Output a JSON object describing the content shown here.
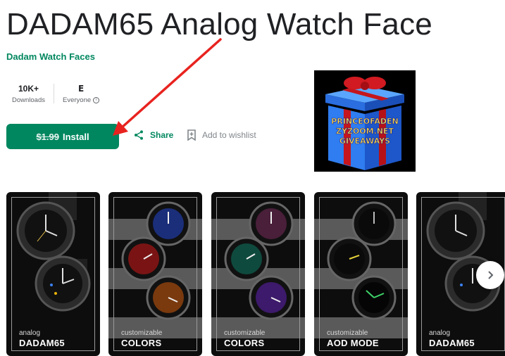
{
  "app": {
    "title": "DADAM65 Analog Watch Face",
    "developer": "Dadam Watch Faces"
  },
  "stats": {
    "downloads_value": "10K+",
    "downloads_label": "Downloads",
    "rating_label": "Everyone"
  },
  "actions": {
    "old_price": "$1.99",
    "install_label": "Install",
    "share_label": "Share",
    "wishlist_label": "Add to wishlist"
  },
  "promo": {
    "lines": [
      "PRINCEOFADEN",
      "ZYZOOM.NET",
      "GIVEAWAYS"
    ]
  },
  "screenshots": [
    {
      "small": "analog",
      "big": "DADAM65"
    },
    {
      "small": "customizable",
      "big": "COLORS"
    },
    {
      "small": "customizable",
      "big": "COLORS"
    },
    {
      "small": "customizable",
      "big": "AOD MODE"
    },
    {
      "small": "analog",
      "big": "DADAM65"
    }
  ],
  "colors": {
    "accent": "#01875f",
    "arrow": "#e8231f"
  },
  "icons": {
    "share": "share-icon",
    "wishlist": "bookmark-add-icon",
    "next": "chevron-right-icon",
    "info": "info-icon"
  }
}
